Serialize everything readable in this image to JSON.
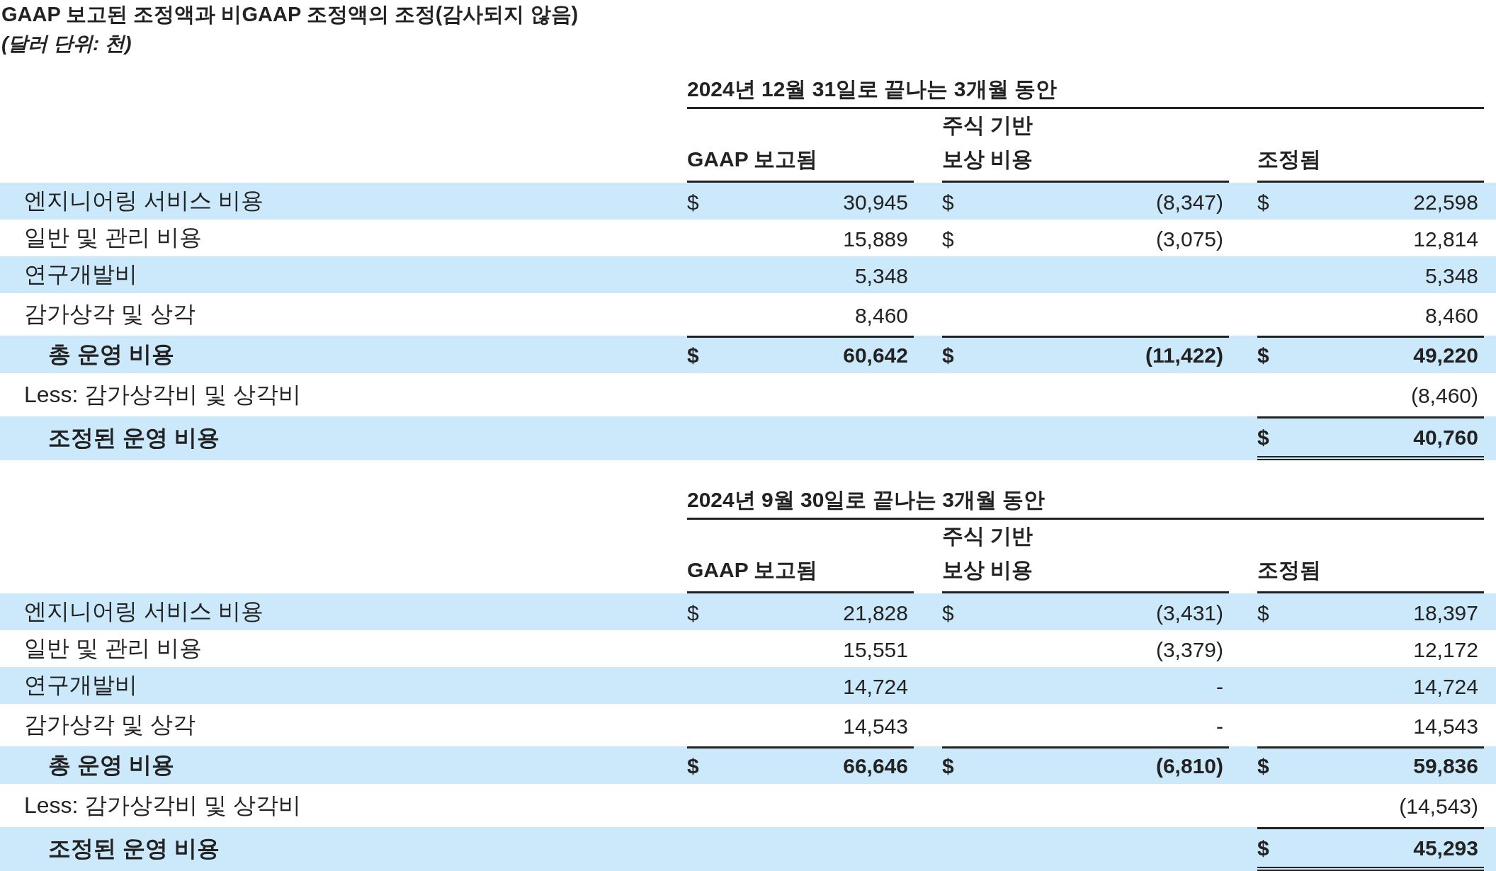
{
  "title": "GAAP 보고된 조정액과 비GAAP 조정액의 조정(감사되지 않음)",
  "subtitle": "(달러 단위: 천)",
  "sections": [
    {
      "period": "2024년 12월 31일로 끝나는 3개월 동안",
      "columns": [
        "GAAP 보고됨",
        "주식 기반 보상 비용",
        "조정됨"
      ],
      "rows": [
        {
          "kind": "item",
          "shaded": true,
          "label": "엔지니어링 서비스 비용",
          "cells": [
            {
              "dollar": "$",
              "value": "30,945"
            },
            {
              "dollar": "$",
              "value": "(8,347)"
            },
            {
              "dollar": "$",
              "value": "22,598"
            }
          ]
        },
        {
          "kind": "item",
          "shaded": false,
          "label": "일반 및 관리 비용",
          "cells": [
            {
              "value": "15,889"
            },
            {
              "dollar": "$",
              "value": "(3,075)"
            },
            {
              "value": "12,814"
            }
          ]
        },
        {
          "kind": "item",
          "shaded": true,
          "label": "연구개발비",
          "cells": [
            {
              "value": "5,348"
            },
            {},
            {
              "value": "5,348"
            }
          ]
        },
        {
          "kind": "item",
          "shaded": false,
          "label": "감가상각 및 상각",
          "cells": [
            {
              "value": "8,460"
            },
            {},
            {
              "value": "8,460"
            }
          ]
        },
        {
          "kind": "total",
          "shaded": true,
          "label": "총 운영 비용",
          "cells": [
            {
              "dollar": "$",
              "value": "60,642"
            },
            {
              "dollar": "$",
              "value": "(11,422)"
            },
            {
              "dollar": "$",
              "value": "49,220"
            }
          ]
        },
        {
          "kind": "less",
          "shaded": false,
          "label": "Less: 감가상각비 및 상각비",
          "cells": [
            {},
            {},
            {
              "value": "(8,460)"
            }
          ]
        },
        {
          "kind": "adjusted",
          "shaded": true,
          "label": "조정된 운영 비용",
          "cells": [
            {},
            {},
            {
              "dollar": "$",
              "value": "40,760"
            }
          ]
        }
      ]
    },
    {
      "period": "2024년 9월 30일로 끝나는 3개월 동안",
      "columns": [
        "GAAP 보고됨",
        "주식 기반 보상 비용",
        "조정됨"
      ],
      "rows": [
        {
          "kind": "item",
          "shaded": true,
          "label": "엔지니어링 서비스 비용",
          "cells": [
            {
              "dollar": "$",
              "value": "21,828"
            },
            {
              "dollar": "$",
              "value": "(3,431)"
            },
            {
              "dollar": "$",
              "value": "18,397"
            }
          ]
        },
        {
          "kind": "item",
          "shaded": false,
          "label": "일반 및 관리 비용",
          "cells": [
            {
              "value": "15,551"
            },
            {
              "value": "(3,379)"
            },
            {
              "value": "12,172"
            }
          ]
        },
        {
          "kind": "item",
          "shaded": true,
          "label": "연구개발비",
          "cells": [
            {
              "value": "14,724"
            },
            {
              "value": "-"
            },
            {
              "value": "14,724"
            }
          ]
        },
        {
          "kind": "item",
          "shaded": false,
          "label": "감가상각 및 상각",
          "cells": [
            {
              "value": "14,543"
            },
            {
              "value": "-"
            },
            {
              "value": "14,543"
            }
          ]
        },
        {
          "kind": "total",
          "shaded": true,
          "label": "총 운영 비용",
          "cells": [
            {
              "dollar": "$",
              "value": "66,646"
            },
            {
              "dollar": "$",
              "value": "(6,810)"
            },
            {
              "dollar": "$",
              "value": "59,836"
            }
          ]
        },
        {
          "kind": "less",
          "shaded": false,
          "label": "Less: 감가상각비 및 상각비",
          "cells": [
            {},
            {},
            {
              "value": "(14,543)"
            }
          ]
        },
        {
          "kind": "adjusted",
          "shaded": true,
          "label": "조정된 운영 비용",
          "cells": [
            {},
            {},
            {
              "dollar": "$",
              "value": "45,293"
            }
          ]
        }
      ]
    }
  ]
}
